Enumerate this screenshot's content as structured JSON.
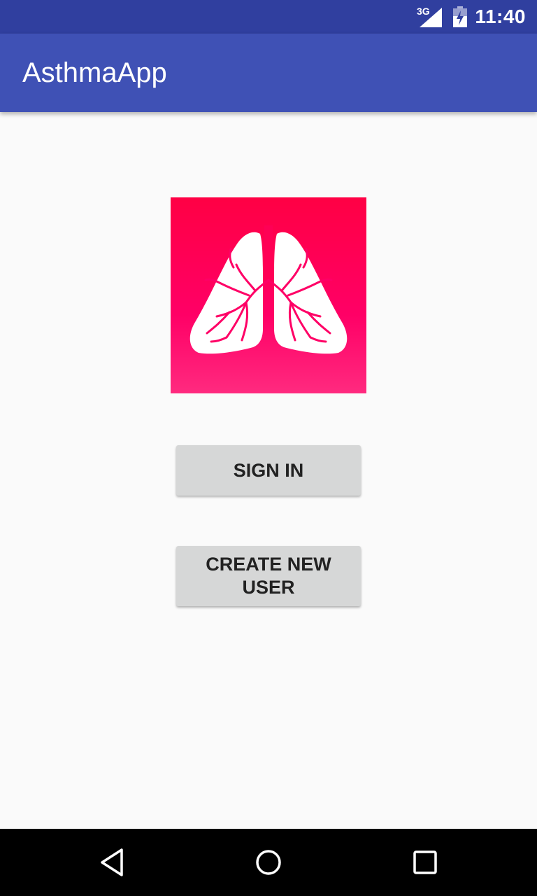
{
  "status_bar": {
    "network_label": "3G",
    "time": "11:40",
    "icons": [
      "signal-icon",
      "battery-icon"
    ]
  },
  "app_bar": {
    "title": "AsthmaApp"
  },
  "logo": {
    "icon": "lungs-icon",
    "colors": {
      "background_top": "#ff0044",
      "background_bottom": "#ff2a7f",
      "lungs": "#ffffff"
    }
  },
  "buttons": {
    "sign_in": "SIGN IN",
    "create_new_user": "CREATE NEW USER"
  },
  "nav_bar": {
    "icons": [
      "back-icon",
      "home-icon",
      "recents-icon"
    ]
  },
  "colors": {
    "status_bar": "#303f9f",
    "app_bar": "#3f51b5",
    "background": "#fafafa",
    "button": "#d6d7d7",
    "nav_bar": "#000000"
  }
}
